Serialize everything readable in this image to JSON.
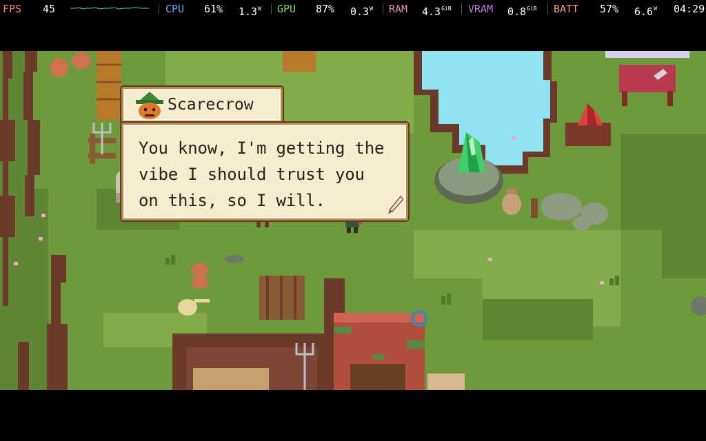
{
  "perf_overlay": {
    "fps_label": "FPS",
    "fps_value": "45",
    "cpu_label": "CPU",
    "cpu_load": "61%",
    "cpu_power": "1.3",
    "cpu_power_unit": "W",
    "gpu_label": "GPU",
    "gpu_load": "87%",
    "gpu_power": "0.3",
    "gpu_power_unit": "W",
    "ram_label": "RAM",
    "ram_value": "4.3",
    "ram_unit": "GiB",
    "vram_label": "VRAM",
    "vram_value": "0.8",
    "vram_unit": "GiB",
    "batt_label": "BATT",
    "batt_percent": "57%",
    "batt_power": "6.6",
    "batt_power_unit": "W",
    "clock": "04:29",
    "colors": {
      "fps": "#ff7b7b",
      "cpu": "#5aaaff",
      "gpu": "#7ddc5a",
      "ram": "#e08fb0",
      "vram": "#c07ae0",
      "batt": "#ff9a6b",
      "graph": "#5fd36a"
    }
  },
  "dialogue": {
    "speaker": "Scarecrow",
    "lines": [
      "You know, I'm getting the",
      "vibe I should trust you",
      "on this, so I will."
    ],
    "portrait_icon": "scarecrow-pumpkin-portrait",
    "advance_icon": "quill-icon"
  },
  "scene": {
    "colors": {
      "grass": "#6f9a3c",
      "grass_dark": "#5e8634",
      "dirt": "#6b3a2a",
      "water": "#8fe3f2",
      "path": "#a3c063"
    }
  }
}
